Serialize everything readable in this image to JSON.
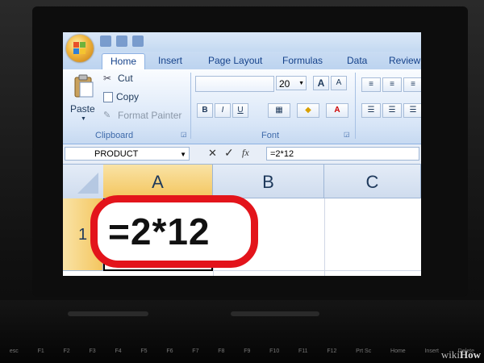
{
  "ribbon": {
    "tabs": [
      "Home",
      "Insert",
      "Page Layout",
      "Formulas",
      "Data",
      "Review"
    ],
    "active_tab": "Home",
    "clipboard": {
      "paste_label": "Paste",
      "cut_label": "Cut",
      "copy_label": "Copy",
      "format_painter_label": "Format Painter",
      "group_label": "Clipboard"
    },
    "font": {
      "font_size": "20",
      "bold_label": "B",
      "italic_label": "I",
      "underline_label": "U",
      "grow_label": "A",
      "shrink_label": "A",
      "group_label": "Font"
    }
  },
  "formula_bar": {
    "name_box": "PRODUCT",
    "fx_label": "fx",
    "formula": "=2*12"
  },
  "grid": {
    "columns": [
      "A",
      "B",
      "C"
    ],
    "selected_column": "A",
    "rows": [
      "1"
    ],
    "cell_a1": "=2*12"
  },
  "keyboard": {
    "keys": [
      "esc",
      "F1",
      "F2",
      "F3",
      "F4",
      "F5",
      "F6",
      "F7",
      "F8",
      "F9",
      "F10",
      "F11",
      "F12",
      "Prt Sc",
      "Home",
      "Insert",
      "Delete"
    ]
  },
  "watermark": {
    "prefix": "wiki",
    "suffix": "How"
  },
  "colors": {
    "highlight": "#e3141b",
    "selected_header": "#f4c65f",
    "ribbon_blue": "#c4d9f1"
  }
}
